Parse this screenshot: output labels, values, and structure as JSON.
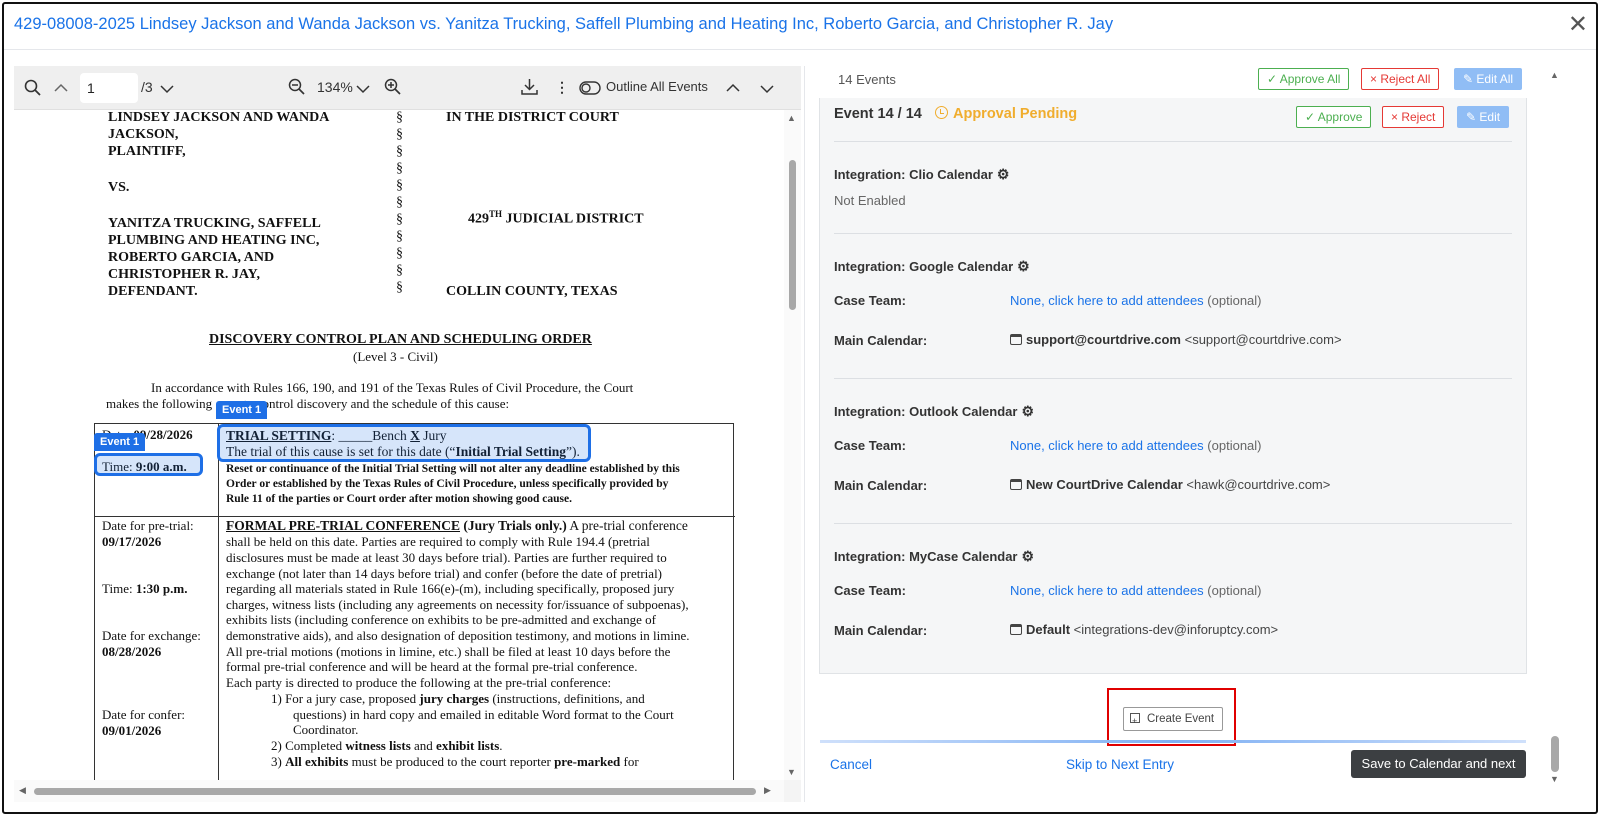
{
  "modal": {
    "title": "429-08008-2025 Lindsey Jackson and Wanda Jackson vs. Yanitza Trucking, Saffell Plumbing and Heating Inc, Roberto Garcia, and Christopher R. Jay",
    "close": "✕"
  },
  "viewer": {
    "page": "1",
    "page_total": "/3",
    "zoom": "134%",
    "outline_label": "Outline All Events"
  },
  "doc": {
    "left_caption": [
      "LINDSEY JACKSON AND WANDA",
      "JACKSON,",
      "PLAINTIFF,",
      "VS.",
      "YANITZA TRUCKING, SAFFELL",
      "PLUMBING AND HEATING INC,",
      "ROBERTO GARCIA, AND",
      "CHRISTOPHER R. JAY,",
      "DEFENDANT."
    ],
    "right_court": "IN THE DISTRICT COURT",
    "right_district_num": "429",
    "right_district_sup": "TH",
    "right_district_txt": " JUDICIAL DISTRICT",
    "right_county": "COLLIN COUNTY, TEXAS",
    "section_char": "§",
    "heading": "DISCOVERY CONTROL PLAN AND SCHEDULING ORDER",
    "subheading": "(Level 3 - Civil)",
    "intro_1": "In accordance with Rules 166, 190, and 191 of the Texas Rules of Civil Procedure, the Court",
    "intro_2a": "makes the following ",
    "intro_2b": "to control discovery and the schedule of this cause:",
    "event_tag": "Event 1",
    "date_label": "Date:",
    "trial_date": "09/28/2026",
    "time_prefix": "Time:",
    "time_value": "9:00 a.m.",
    "trial_setting": "TRIAL SETTING",
    "trial_bench": ": _____Bench",
    "trial_x": "X",
    "trial_jury": " Jury",
    "trial_line2a": "The trial of this cause is set for this date (“",
    "trial_line2b": "Initial Trial Setting",
    "trial_line2c": "”).",
    "reset_lines": [
      "Reset or continuance of the Initial Trial Setting will not alter any deadline established by this",
      "Order or established by the Texas Rules of Civil Procedure, unless specifically provided by",
      "Rule 11 of the parties or Court order after motion showing good cause."
    ],
    "left_col": [
      "Date for pre-trial:",
      "09/17/2026",
      "Time:",
      "1:30 p.m.",
      "Date for exchange:",
      "08/28/2026",
      "Date for confer:",
      "09/01/2026"
    ],
    "formal_title": "FORMAL PRE-TRIAL CONFERENCE",
    "formal_tail": " (Jury Trials only.)",
    "formal_rest": "  A pre-trial conference",
    "body_lines": [
      "shall be held on this date.  Parties are required to comply with Rule 194.4 (pretrial",
      "disclosures must be made at least 30 days before trial).  Parties are further required to",
      "exchange (not later than 14 days before trial) and confer (before the date of pretrial)",
      "regarding all materials stated in Rule 166(e)-(m), including specifically, proposed jury",
      "charges, witness lists (including any agreements on necessity for/issuance of subpoenas),",
      "exhibits lists (including conference on exhibits to be pre-admitted and exchange of",
      "demonstrative aids), and also designation of deposition testimony, and motions in limine.",
      "All pre-trial motions (motions in limine, etc.) shall be filed at least 10 days before the",
      "formal pre-trial conference and will be heard at the formal pre-trial conference.",
      "Each party is directed to produce the following at the pre-trial conference:"
    ],
    "list_1a": "1)   For a jury case, proposed ",
    "list_1b": "jury charges",
    "list_1c": " (instructions, definitions, and",
    "list_1d": "questions) in hard copy and emailed in editable Word format to the Court",
    "list_1e": "Coordinator.",
    "list_2a": "2)   Completed ",
    "list_2b": "witness lists",
    "list_2c": " and ",
    "list_2d": "exhibit lists",
    "list_2e": ".",
    "list_3a": "3)   ",
    "list_3b": "All exhibits",
    "list_3c": " must be produced to the court reporter ",
    "list_3d": "pre-marked",
    "list_3e": " for"
  },
  "panel": {
    "events_count": "14 Events",
    "approve_all": "Approve All",
    "reject_all": "Reject All",
    "edit_all": "Edit All",
    "event_title": "Event 14 / 14",
    "status": "Approval Pending",
    "approve": "Approve",
    "reject": "Reject",
    "edit": "Edit",
    "clio": {
      "label": "Integration: Clio Calendar",
      "status": "Not Enabled"
    },
    "google": {
      "label": "Integration: Google Calendar",
      "case_team_label": "Case Team:",
      "case_team_link": "None, click here to add attendees",
      "case_team_opt": " (optional)",
      "main_label": "Main Calendar:",
      "main_name": "support@courtdrive.com",
      "main_email": " <support@courtdrive.com>"
    },
    "outlook": {
      "label": "Integration: Outlook Calendar",
      "case_team_label": "Case Team:",
      "case_team_link": "None, click here to add attendees",
      "case_team_opt": " (optional)",
      "main_label": "Main Calendar:",
      "main_name": "New CourtDrive Calendar",
      "main_email": " <hawk@courtdrive.com>"
    },
    "mycase": {
      "label": "Integration: MyCase Calendar",
      "case_team_label": "Case Team:",
      "case_team_link": "None, click here to add attendees",
      "case_team_opt": " (optional)",
      "main_label": "Main Calendar:",
      "main_name": "Default",
      "main_email": " <integrations-dev@inforuptcy.com>"
    },
    "create_event": "Create Event",
    "cancel": "Cancel",
    "skip": "Skip to Next Entry",
    "save": "Save to Calendar and next"
  },
  "colors": {
    "accent": "#1a73e8",
    "pending": "#f0ad2e",
    "approve": "#4caf50",
    "reject": "#e53935",
    "highlight": "#1e6fe6"
  }
}
